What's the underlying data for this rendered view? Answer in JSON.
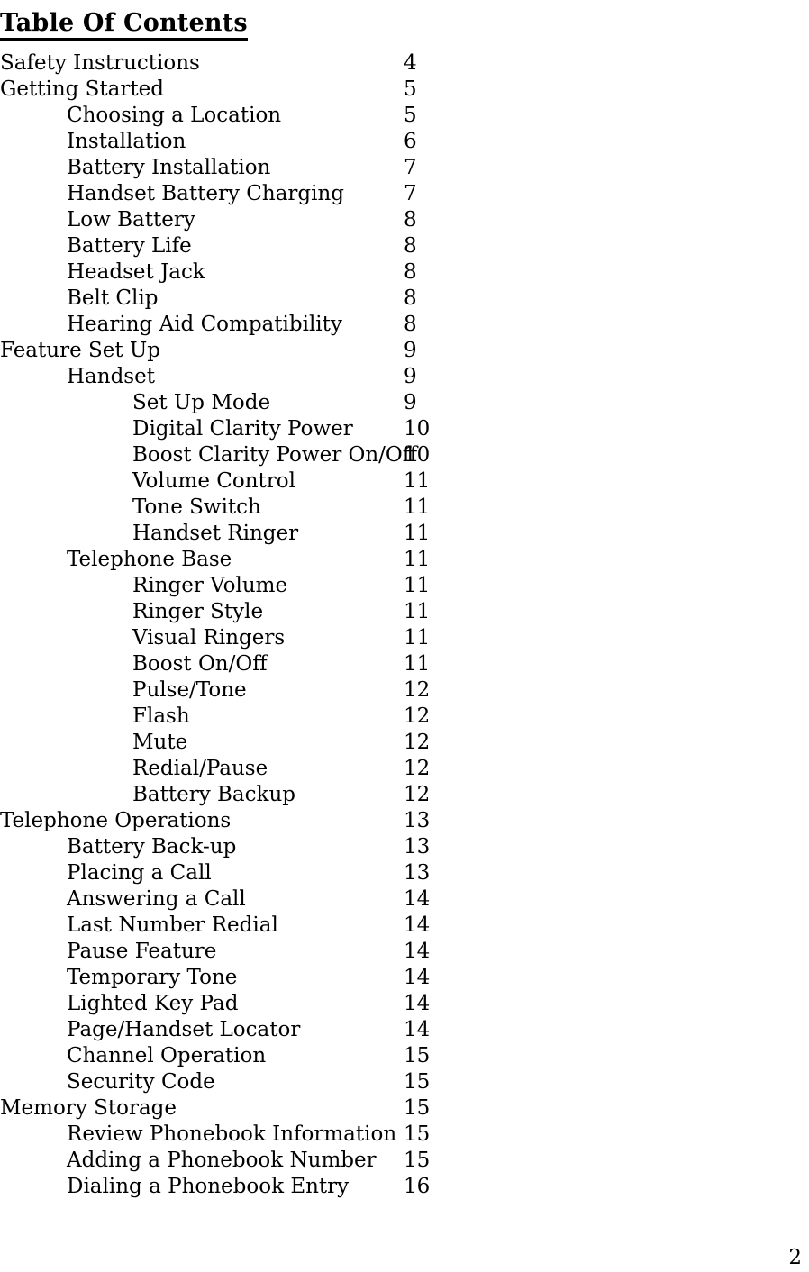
{
  "document": {
    "heading": "Table Of Contents",
    "footer_page_number": "2"
  },
  "toc": {
    "entries": [
      {
        "title": "Safety Instructions",
        "page": "4",
        "level": 1
      },
      {
        "title": "Getting Started",
        "page": "5",
        "level": 1
      },
      {
        "title": "Choosing a Location",
        "page": "5",
        "level": 2
      },
      {
        "title": "Installation",
        "page": "6",
        "level": 2
      },
      {
        "title": "Battery Installation",
        "page": "7",
        "level": 2
      },
      {
        "title": "Handset Battery Charging",
        "page": "7",
        "level": 2
      },
      {
        "title": "Low Battery",
        "page": "8",
        "level": 2
      },
      {
        "title": "Battery Life",
        "page": "8",
        "level": 2
      },
      {
        "title": "Headset Jack",
        "page": "8",
        "level": 2
      },
      {
        "title": "Belt Clip",
        "page": "8",
        "level": 2
      },
      {
        "title": "Hearing Aid Compatibility",
        "page": "8",
        "level": 2
      },
      {
        "title": "Feature Set Up",
        "page": "9",
        "level": 1
      },
      {
        "title": "Handset",
        "page": "9",
        "level": 2
      },
      {
        "title": "Set Up Mode",
        "page": "9",
        "level": 3
      },
      {
        "title": "Digital Clarity Power",
        "page": "10",
        "level": 3
      },
      {
        "title": "Boost Clarity Power On/Off",
        "page": "10",
        "level": 3
      },
      {
        "title": "Volume Control",
        "page": "11",
        "level": 3
      },
      {
        "title": "Tone Switch",
        "page": "11",
        "level": 3
      },
      {
        "title": "Handset Ringer",
        "page": "11",
        "level": 3
      },
      {
        "title": "Telephone Base",
        "page": "11",
        "level": 2
      },
      {
        "title": "Ringer Volume",
        "page": "11",
        "level": 3
      },
      {
        "title": "Ringer Style",
        "page": "11",
        "level": 3
      },
      {
        "title": "Visual Ringers",
        "page": "11",
        "level": 3
      },
      {
        "title": "Boost On/Off",
        "page": "11",
        "level": 3
      },
      {
        "title": "Pulse/Tone",
        "page": "12",
        "level": 3
      },
      {
        "title": "Flash",
        "page": "12",
        "level": 3
      },
      {
        "title": "Mute",
        "page": "12",
        "level": 3
      },
      {
        "title": "Redial/Pause",
        "page": "12",
        "level": 3
      },
      {
        "title": "Battery Backup",
        "page": "12",
        "level": 3
      },
      {
        "title": "Telephone Operations",
        "page": "13",
        "level": 1
      },
      {
        "title": "Battery Back-up",
        "page": "13",
        "level": 2
      },
      {
        "title": "Placing a Call",
        "page": "13",
        "level": 2
      },
      {
        "title": "Answering a Call",
        "page": "14",
        "level": 2
      },
      {
        "title": "Last Number Redial",
        "page": "14",
        "level": 2
      },
      {
        "title": "Pause Feature",
        "page": "14",
        "level": 2
      },
      {
        "title": "Temporary Tone",
        "page": "14",
        "level": 2
      },
      {
        "title": "Lighted Key Pad",
        "page": "14",
        "level": 2
      },
      {
        "title": "Page/Handset Locator",
        "page": "14",
        "level": 2
      },
      {
        "title": "Channel Operation",
        "page": "15",
        "level": 2
      },
      {
        "title": "Security Code",
        "page": "15",
        "level": 2
      },
      {
        "title": "Memory Storage",
        "page": "15",
        "level": 1
      },
      {
        "title": "Review Phonebook Information",
        "page": "15",
        "level": 2
      },
      {
        "title": "Adding a Phonebook Number",
        "page": "15",
        "level": 2
      },
      {
        "title": "Dialing a Phonebook Entry",
        "page": "16",
        "level": 2
      }
    ]
  }
}
